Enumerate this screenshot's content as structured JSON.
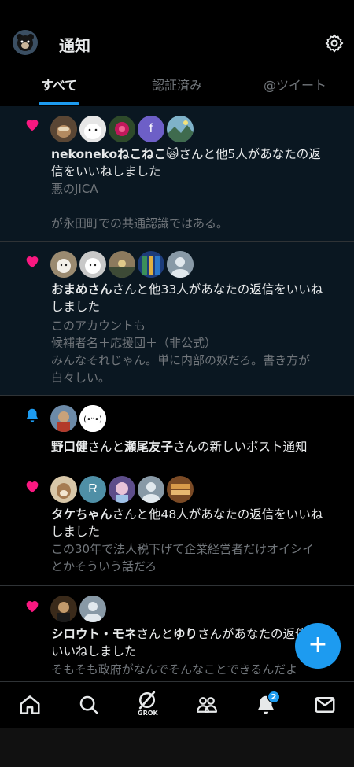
{
  "header": {
    "title": "通知"
  },
  "tabs": [
    {
      "label": "すべて",
      "active": true
    },
    {
      "label": "認証済み",
      "active": false
    },
    {
      "label": "@ツイート",
      "active": false
    }
  ],
  "notifications": [
    {
      "kind": "like",
      "actor": "nekonekoねこねこ",
      "actor_emoji": "🙀",
      "rest_line1": "さんと他5人があなたの返",
      "rest_line2": "信をいいねしました",
      "quote": "悪のJICA\n\nが永田町での共通認識ではある。"
    },
    {
      "kind": "like",
      "actor": "おまめさん",
      "rest_line1": "さんと他33人があなたの返信をいいね",
      "rest_line2": "しました",
      "quote": "このアカウントも\n候補者名＋応援団＋（非公式）\nみんなそれじゃん。単に内部の奴だろ。書き方が\n白々しい。"
    },
    {
      "kind": "post",
      "actor": "野口健",
      "mid": "さんと",
      "actor2": "瀬尾友子",
      "rest_line1": "さんの新しいポスト通知"
    },
    {
      "kind": "like",
      "actor": "タケちゃん",
      "rest_line1": "さんと他48人があなたの返信をいいね",
      "rest_line2": "しました",
      "quote": "この30年で法人税下げて企業経営者だけオイシイ\nとかそういう話だろ",
      "avatar_letter": "R"
    },
    {
      "kind": "like",
      "actor": "シロウト・モネ",
      "mid": "さんと",
      "actor2": "ゆり",
      "rest_line1": "さんがあなたの返信を",
      "rest_line2": "いいねしました",
      "quote": "そもそも政府がなんでそんなことできるんだよ"
    }
  ],
  "avatar_letter_f": "f",
  "bottom_nav": {
    "grok_label": "GROK",
    "notification_badge": "2"
  },
  "colors": {
    "accent": "#1d9bf0",
    "like": "#f91880",
    "unread_bg": "#0a1721"
  },
  "icons": [
    "gear-icon",
    "heart-icon",
    "bell-icon",
    "home-icon",
    "search-icon",
    "grok-icon",
    "communities-icon",
    "notifications-icon",
    "messages-icon",
    "compose-plus-icon"
  ]
}
